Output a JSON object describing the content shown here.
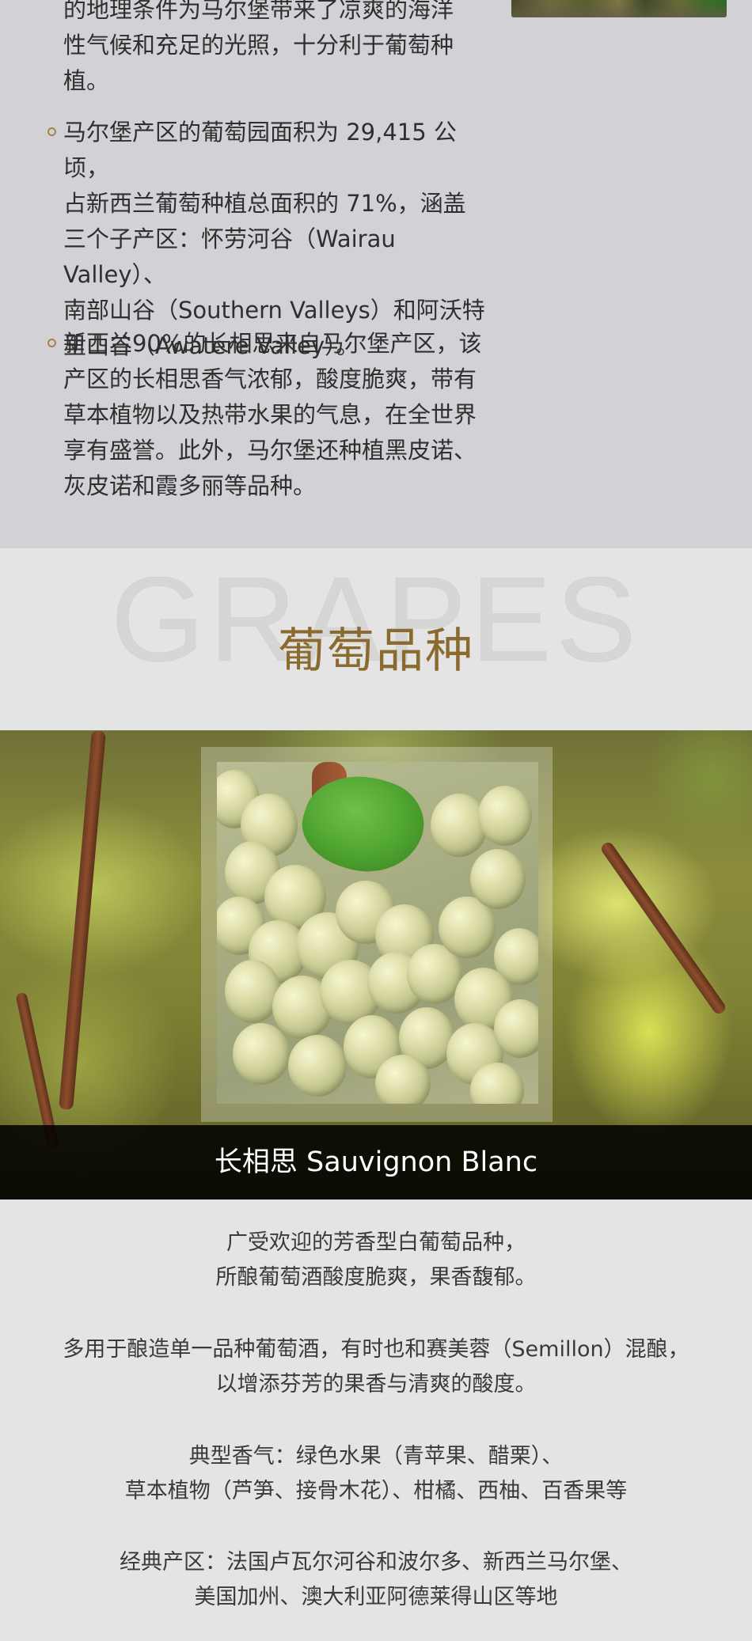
{
  "region_paragraphs": [
    {
      "lines": [
        "的地理条件为马尔堡带来了凉爽的海洋",
        "性气候和充足的光照，十分利于葡萄种",
        "植。"
      ],
      "bullet": false
    },
    {
      "lines": [
        "马尔堡产区的葡萄园面积为 29,415 公顷，",
        "占新西兰葡萄种植总面积的 71%，涵盖",
        "三个子产区：怀劳河谷（Wairau Valley）、",
        "南部山谷（Southern Valleys）和阿沃特",
        "里山谷（Awatere Valley）。"
      ],
      "bullet": true
    },
    {
      "lines": [
        "新西兰90%的长相思来自马尔堡产区，该",
        "产区的长相思香气浓郁，酸度脆爽，带有",
        "草本植物以及热带水果的气息，在全世界",
        "享有盛誉。此外，马尔堡还种植黑皮诺、",
        "灰皮诺和霞多丽等品种。"
      ],
      "bullet": true
    }
  ],
  "section": {
    "bg_word": "GRAPES",
    "title": "葡萄品种"
  },
  "grape": {
    "caption": "长相思 Sauvignon Blanc"
  },
  "description": [
    [
      "广受欢迎的芳香型白葡萄品种，",
      "所酿葡萄酒酸度脆爽，果香馥郁。"
    ],
    [
      "多用于酿造单一品种葡萄酒，有时也和赛美蓉（Semillon）混酿，",
      "以增添芬芳的果香与清爽的酸度。"
    ],
    [
      "典型香气：绿色水果（青苹果、醋栗）、",
      "草本植物（芦笋、接骨木花）、柑橘、西柚、百香果等"
    ],
    [
      "经典产区：法国卢瓦尔河谷和波尔多、新西兰马尔堡、",
      "美国加州、澳大利亚阿德莱得山区等地"
    ]
  ],
  "colors": {
    "accent": "#8a6a2e",
    "bullet": "#a3844a",
    "top_bg": "#d2d1d5",
    "page_bg": "#e4e4e5"
  }
}
